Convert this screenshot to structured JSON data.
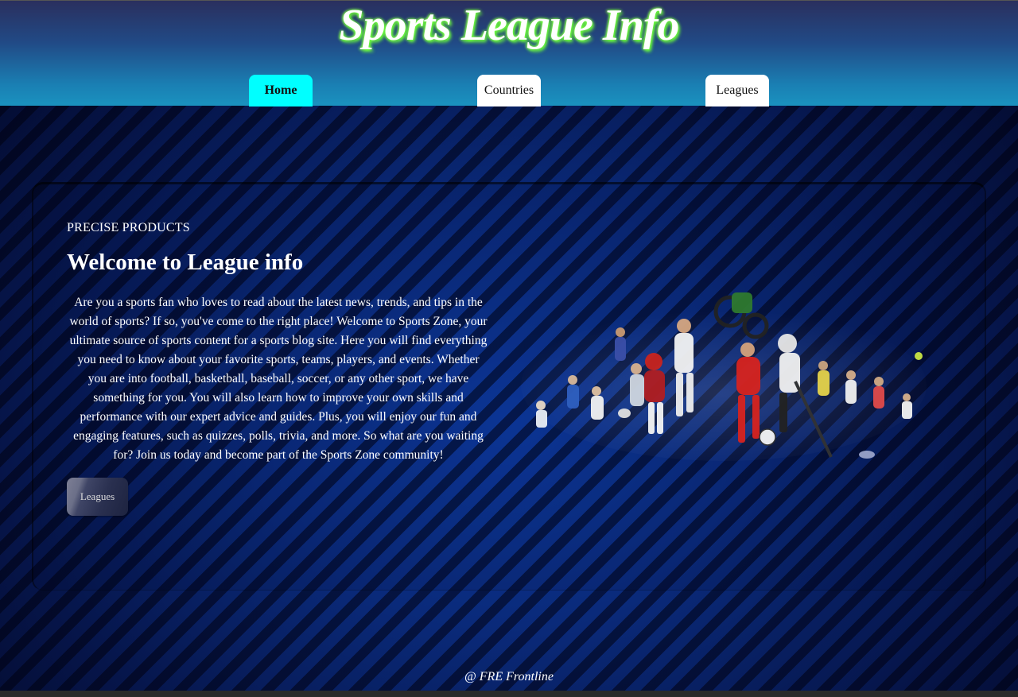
{
  "header": {
    "site_title": "Sports League Info",
    "nav": [
      {
        "label": "Home",
        "active": true
      },
      {
        "label": "Countries",
        "active": false
      },
      {
        "label": "Leagues",
        "active": false
      }
    ]
  },
  "main": {
    "eyebrow": "PRECISE PRODUCTS",
    "headline": "Welcome to League info",
    "intro": "Are you a sports fan who loves to read about the latest news, trends, and tips in the world of sports? If so, you've come to the right place! Welcome to Sports Zone, your ultimate source of sports content for a sports blog site. Here you will find everything you need to know about your favorite sports, teams, players, and events. Whether you are into football, basketball, baseball, soccer, or any other sport, we have something for you. You will also learn how to improve your own skills and performance with our expert advice and guides. Plus, you will enjoy our fun and engaging features, such as quizzes, polls, trivia, and more. So what are you waiting for? Join us today and become part of the Sports Zone community!",
    "button_label": "Leagues"
  },
  "footer": {
    "text": "@ FRE Frontline"
  },
  "colors": {
    "title_glow": "#6bff3a",
    "active_tab": "#00ffff",
    "tab": "#ffffff"
  }
}
